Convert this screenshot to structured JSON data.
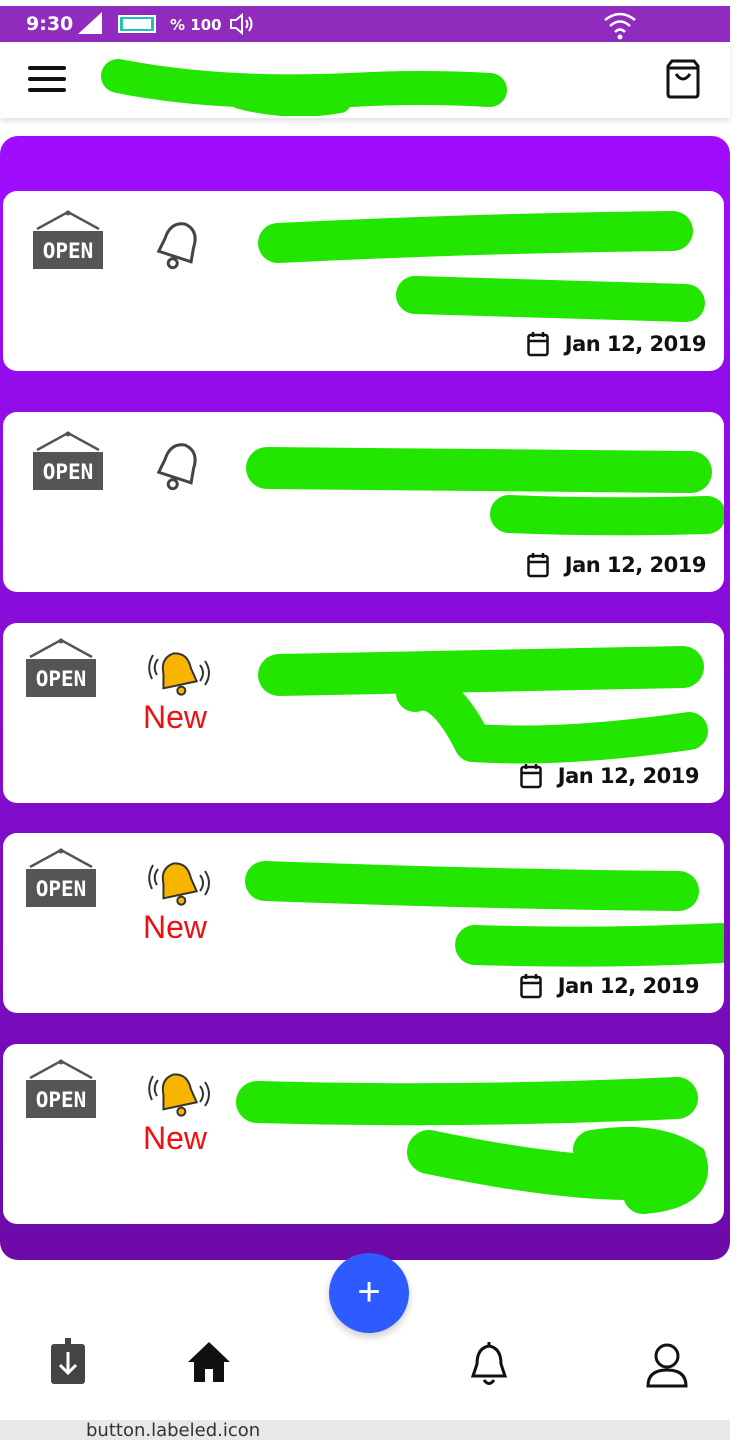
{
  "status_bar": {
    "time": "9:30",
    "battery": "% 100",
    "icons": [
      "signal-icon",
      "battery-icon",
      "volume-icon",
      "wifi-icon"
    ]
  },
  "app_bar": {
    "icons": [
      "menu-icon",
      "shopping-bag-icon"
    ]
  },
  "cards": [
    {
      "status_sign": "OPEN",
      "is_new": false,
      "new_label": "",
      "date": "Jan 12, 2019"
    },
    {
      "status_sign": "OPEN",
      "is_new": false,
      "new_label": "",
      "date": "Jan 12, 2019"
    },
    {
      "status_sign": "OPEN",
      "is_new": true,
      "new_label": "New",
      "date": "Jan 12, 2019"
    },
    {
      "status_sign": "OPEN",
      "is_new": true,
      "new_label": "New",
      "date": "Jan 12, 2019"
    },
    {
      "status_sign": "OPEN",
      "is_new": true,
      "new_label": "New",
      "date": ""
    }
  ],
  "fab": {
    "label": "+"
  },
  "bottom_nav": {
    "items": [
      "download-icon",
      "home-icon",
      "bell-icon",
      "profile-icon"
    ]
  },
  "footer": {
    "text": "button.labeled.icon"
  },
  "colors": {
    "status_bar": "#8f2bbd",
    "panel_top": "#a10cff",
    "panel_bottom": "#6e0aa8",
    "redaction": "#22e600",
    "new_text": "#e11111",
    "fab": "#2e5bff"
  }
}
